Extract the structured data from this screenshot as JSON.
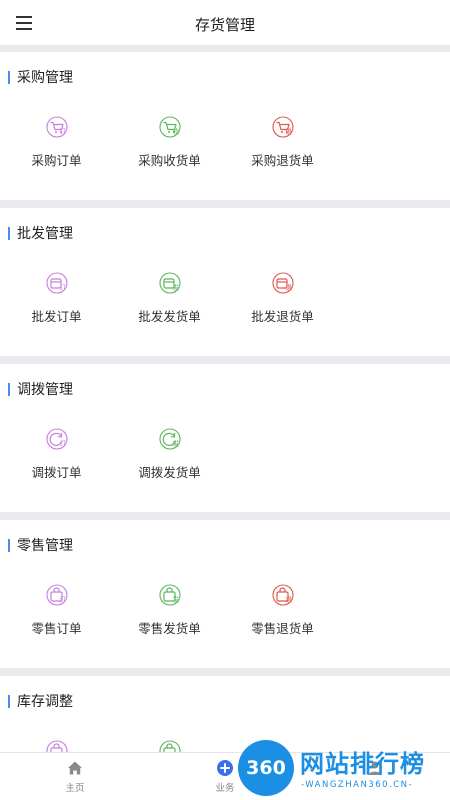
{
  "header": {
    "title": "存货管理",
    "menu_icon": "menu-icon"
  },
  "sections": [
    {
      "title": "采购管理",
      "items": [
        {
          "label": "采购订单",
          "icon": "cart-order-icon",
          "badge": "订",
          "color": "#c77ee0"
        },
        {
          "label": "采购收货单",
          "icon": "cart-receive-icon",
          "badge": "收",
          "color": "#5cb65c"
        },
        {
          "label": "采购退货单",
          "icon": "cart-return-icon",
          "badge": "退",
          "color": "#e0584e"
        }
      ]
    },
    {
      "title": "批发管理",
      "items": [
        {
          "label": "批发订单",
          "icon": "wholesale-order-icon",
          "badge": "订",
          "color": "#c77ee0"
        },
        {
          "label": "批发发货单",
          "icon": "wholesale-ship-icon",
          "badge": "发",
          "color": "#5cb65c"
        },
        {
          "label": "批发退货单",
          "icon": "wholesale-return-icon",
          "badge": "退",
          "color": "#e0584e"
        }
      ]
    },
    {
      "title": "调拨管理",
      "items": [
        {
          "label": "调拨订单",
          "icon": "transfer-order-icon",
          "badge": "订",
          "color": "#c77ee0"
        },
        {
          "label": "调拨发货单",
          "icon": "transfer-ship-icon",
          "badge": "发",
          "color": "#5cb65c"
        }
      ]
    },
    {
      "title": "零售管理",
      "items": [
        {
          "label": "零售订单",
          "icon": "retail-order-icon",
          "badge": "订",
          "color": "#c77ee0"
        },
        {
          "label": "零售发货单",
          "icon": "retail-ship-icon",
          "badge": "发",
          "color": "#5cb65c"
        },
        {
          "label": "零售退货单",
          "icon": "retail-return-icon",
          "badge": "退",
          "color": "#e0584e"
        }
      ]
    },
    {
      "title": "库存调整",
      "items": [
        {
          "label": "",
          "icon": "stock-adjust-icon",
          "badge": "",
          "color": "#c77ee0"
        },
        {
          "label": "",
          "icon": "stock-adjust-icon",
          "badge": "",
          "color": "#5cb65c"
        }
      ]
    }
  ],
  "tabbar": {
    "items": [
      {
        "label": "主页",
        "icon": "home-icon"
      },
      {
        "label": "业务",
        "icon": "plus-circle-icon"
      },
      {
        "label": "",
        "icon": "user-icon"
      }
    ],
    "active_color": "#3a6fe8"
  },
  "watermark": {
    "logo_text": "360",
    "cn_text": "网站排行榜",
    "en_text": "-WANGZHAN360.CN-"
  }
}
